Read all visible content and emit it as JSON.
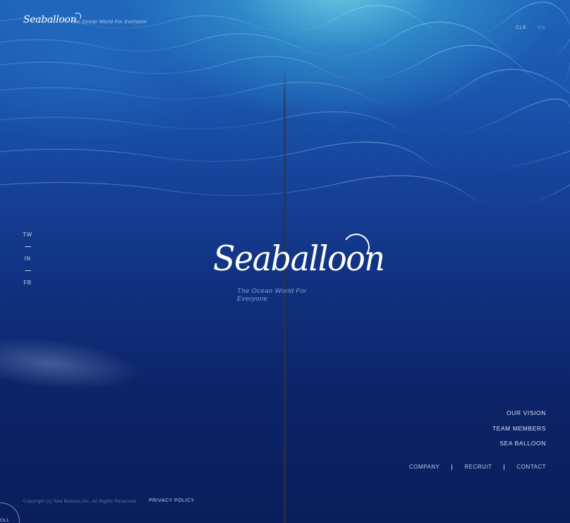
{
  "header": {
    "logo_text": "Seaballoon",
    "tagline": "The Ocean World For Everyone",
    "lang_ja": "CLE",
    "lang_en": "EN"
  },
  "social": {
    "items": [
      {
        "label": "TW"
      },
      {
        "label": "IN"
      },
      {
        "label": "FB"
      }
    ]
  },
  "hero": {
    "logo_text": "Seaballoon",
    "tagline": "The Ocean World For Everyone"
  },
  "right_nav": {
    "items": [
      {
        "label": "OUR VISION"
      },
      {
        "label": "TEAM MEMBERS"
      },
      {
        "label": "SEA BALLOON"
      }
    ]
  },
  "bottom_nav": {
    "items": [
      {
        "label": "COMPANY"
      },
      {
        "label": "RECRUIT"
      },
      {
        "label": "CONTACT"
      }
    ]
  },
  "footer": {
    "copyright": "Copyright (c) Sea Balloon,Inc. All Rights Reserved.",
    "privacy": "PRIVACY POLICY",
    "scroll": "OLL"
  },
  "colors": {
    "background_deep": "#0a1f5c",
    "background_surface": "#1e63b8",
    "highlight": "#78dceb",
    "text": "#ffffff"
  }
}
